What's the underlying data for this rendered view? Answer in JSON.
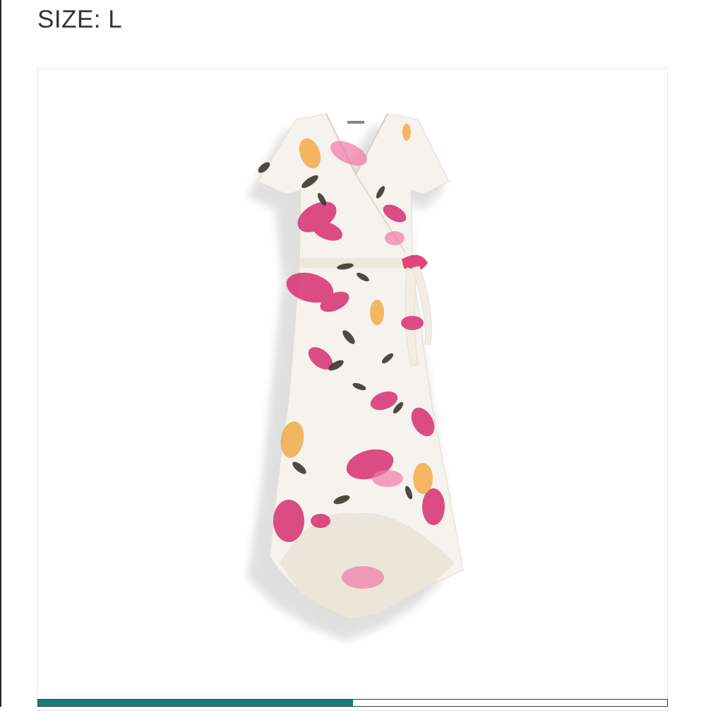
{
  "header": {
    "size_label": "SIZE: L"
  },
  "product_card": {
    "image_icon": "floral-wrap-dress-image"
  },
  "carousel": {
    "progress_fraction": 0.5,
    "fill_color": "#137f7b"
  },
  "colors": {
    "text": "#333333",
    "card_border": "#e6e6e6",
    "accent": "#137f7b"
  }
}
